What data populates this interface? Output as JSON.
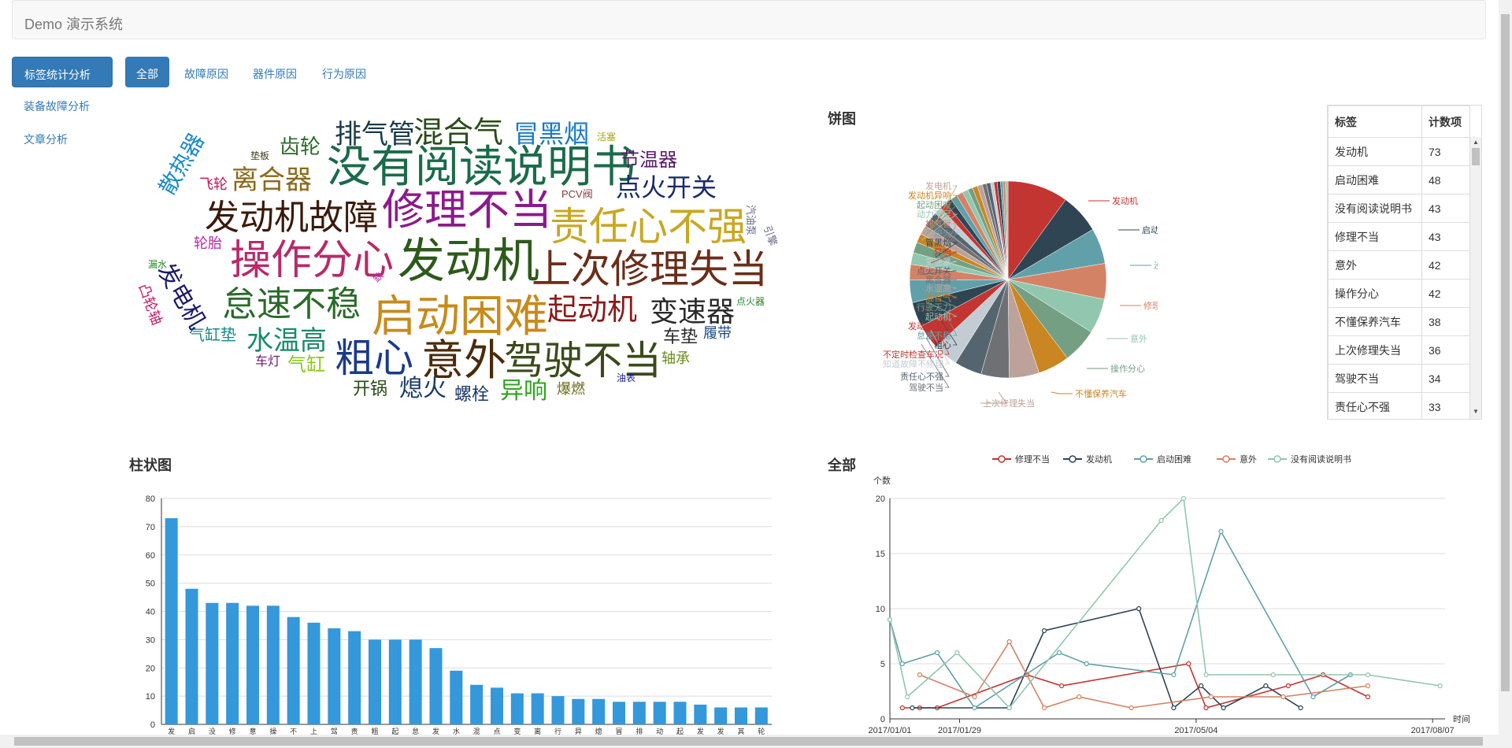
{
  "app": {
    "brand": "Demo 演示系统"
  },
  "sidebar": {
    "primary": "标签统计分析",
    "links": [
      "装备故障分析",
      "文章分析"
    ]
  },
  "tabs": [
    "全部",
    "故障原因",
    "器件原因",
    "行为原因"
  ],
  "wordcloud": [
    {
      "t": "没有阅读说明书",
      "x": 235,
      "y": 44,
      "s": 56,
      "c": "#1a6b4a"
    },
    {
      "t": "修理不当",
      "x": 305,
      "y": 100,
      "s": 54,
      "c": "#8b1a8b"
    },
    {
      "t": "发动机",
      "x": 325,
      "y": 162,
      "s": 60,
      "c": "#2d5a1a"
    },
    {
      "t": "上次修理失当",
      "x": 495,
      "y": 177,
      "s": 50,
      "c": "#6b2d1a"
    },
    {
      "t": "启动困难",
      "x": 292,
      "y": 234,
      "s": 56,
      "c": "#c88a1a"
    },
    {
      "t": "意外",
      "x": 355,
      "y": 291,
      "s": 54,
      "c": "#4a2a0a"
    },
    {
      "t": "驾驶不当",
      "x": 460,
      "y": 293,
      "s": 50,
      "c": "#3a4a1a"
    },
    {
      "t": "责任心不强",
      "x": 518,
      "y": 123,
      "s": 50,
      "c": "#c8a822"
    },
    {
      "t": "操作分心",
      "x": 112,
      "y": 165,
      "s": 52,
      "c": "#b82a6a"
    },
    {
      "t": "发动机故障",
      "x": 80,
      "y": 115,
      "s": 44,
      "c": "#3a1a0a"
    },
    {
      "t": "怠速不稳",
      "x": 102,
      "y": 225,
      "s": 44,
      "c": "#2a6a2a"
    },
    {
      "t": "粗心",
      "x": 245,
      "y": 290,
      "s": 50,
      "c": "#1a3a8a"
    },
    {
      "t": "起动机",
      "x": 515,
      "y": 235,
      "s": 38,
      "c": "#8a1a1a"
    },
    {
      "t": "变速器",
      "x": 645,
      "y": 238,
      "s": 36,
      "c": "#2a2a2a"
    },
    {
      "t": "混合气",
      "x": 345,
      "y": 10,
      "s": 38,
      "c": "#2a4a1a"
    },
    {
      "t": "排气管",
      "x": 245,
      "y": 14,
      "s": 34,
      "c": "#1a3a4a"
    },
    {
      "t": "冒黑烟",
      "x": 472,
      "y": 14,
      "s": 32,
      "c": "#1a7ac8"
    },
    {
      "t": "点火开关",
      "x": 602,
      "y": 82,
      "s": 32,
      "c": "#1a2a6a"
    },
    {
      "t": "离合器",
      "x": 114,
      "y": 72,
      "s": 34,
      "c": "#8a6a1a"
    },
    {
      "t": "水温高",
      "x": 133,
      "y": 276,
      "s": 34,
      "c": "#1a8a6a"
    },
    {
      "t": "节温器",
      "x": 608,
      "y": 52,
      "s": 24,
      "c": "#5a1a6a"
    },
    {
      "t": "齿轮",
      "x": 175,
      "y": 33,
      "s": 26,
      "c": "#2a6a2a"
    },
    {
      "t": "车垫",
      "x": 662,
      "y": 277,
      "s": 22,
      "c": "#2a2a2a"
    },
    {
      "t": "履带",
      "x": 713,
      "y": 274,
      "s": 18,
      "c": "#1a4a8a"
    },
    {
      "t": "轴承",
      "x": 660,
      "y": 306,
      "s": 18,
      "c": "#6a8a1a"
    },
    {
      "t": "气缸垫",
      "x": 60,
      "y": 276,
      "s": 20,
      "c": "#1a8a8a"
    },
    {
      "t": "车灯",
      "x": 144,
      "y": 312,
      "s": 16,
      "c": "#6a1a6a"
    },
    {
      "t": "气缸",
      "x": 185,
      "y": 312,
      "s": 24,
      "c": "#8ac81a"
    },
    {
      "t": "开锅",
      "x": 268,
      "y": 343,
      "s": 22,
      "c": "#2a4a1a"
    },
    {
      "t": "熄火",
      "x": 327,
      "y": 339,
      "s": 30,
      "c": "#1a3a6a"
    },
    {
      "t": "螺栓",
      "x": 397,
      "y": 350,
      "s": 22,
      "c": "#1a3a6a"
    },
    {
      "t": "异响",
      "x": 455,
      "y": 342,
      "s": 30,
      "c": "#2aa81a"
    },
    {
      "t": "爆燃",
      "x": 527,
      "y": 345,
      "s": 18,
      "c": "#6a6a1a"
    },
    {
      "t": "油表",
      "x": 603,
      "y": 334,
      "s": 12,
      "c": "#1a1a8a"
    },
    {
      "t": "点火器",
      "x": 755,
      "y": 237,
      "s": 12,
      "c": "#1a8a2a"
    },
    {
      "t": "活塞",
      "x": 578,
      "y": 28,
      "s": 12,
      "c": "#a8a81a"
    },
    {
      "t": "垫板",
      "x": 138,
      "y": 52,
      "s": 12,
      "c": "#3a3a1a"
    },
    {
      "t": "PCV阀",
      "x": 533,
      "y": 100,
      "s": 13,
      "c": "#8a3a3a"
    },
    {
      "t": "飞轮",
      "x": 73,
      "y": 85,
      "s": 18,
      "c": "#b81a5a"
    },
    {
      "t": "轮胎",
      "x": 66,
      "y": 160,
      "s": 18,
      "c": "#b82aa8"
    },
    {
      "t": "漏水",
      "x": 8,
      "y": 190,
      "s": 12,
      "c": "#2a8a2a"
    }
  ],
  "wordcloud_vertical": [
    {
      "t": "散热器",
      "x": 18,
      "y": 98,
      "s": 28,
      "c": "#1a8ac8",
      "r": -60
    },
    {
      "t": "发电机",
      "x": 40,
      "y": 190,
      "s": 30,
      "c": "#1a1a6a",
      "r": 60
    },
    {
      "t": "凸轮轴",
      "x": 10,
      "y": 218,
      "s": 18,
      "c": "#c81a6a",
      "r": 70
    },
    {
      "t": "汽油泵",
      "x": 780,
      "y": 120,
      "s": 13,
      "c": "#6a6a8a",
      "r": 90
    },
    {
      "t": "引擎",
      "x": 800,
      "y": 145,
      "s": 13,
      "c": "#6a6a8a",
      "r": 70
    },
    {
      "t": "缺",
      "x": 292,
      "y": 212,
      "s": 12,
      "c": "#b82aa8",
      "r": -45
    }
  ],
  "pie": {
    "title": "饼图",
    "values": [
      73,
      48,
      43,
      43,
      42,
      42,
      38,
      36,
      34,
      33,
      30,
      30,
      30,
      27,
      19,
      14,
      13,
      11,
      11,
      10,
      9,
      9,
      8,
      8,
      8,
      8,
      7,
      6,
      6,
      6,
      5,
      5,
      4,
      4,
      4,
      3,
      3,
      3
    ],
    "colors": [
      "#c23531",
      "#2f4554",
      "#61a0a8",
      "#d48265",
      "#91c7ae",
      "#749f83",
      "#ca8622",
      "#bda29a",
      "#6e7074",
      "#546570",
      "#c4ccd3",
      "#c23531",
      "#2f4554",
      "#61a0a8",
      "#d48265",
      "#91c7ae",
      "#749f83",
      "#ca8622",
      "#bda29a",
      "#6e7074",
      "#546570",
      "#c4ccd3",
      "#c23531",
      "#2f4554",
      "#61a0a8",
      "#d48265",
      "#91c7ae",
      "#749f83",
      "#ca8622",
      "#bda29a",
      "#6e7074",
      "#546570",
      "#c4ccd3",
      "#c23531",
      "#2f4554",
      "#61a0a8",
      "#d48265",
      "#91c7ae"
    ],
    "labels_right": [
      {
        "t": "发动机",
        "c": "#c23531"
      },
      {
        "t": "启动困难",
        "c": "#2f4554"
      },
      {
        "t": "没有阅读说明书",
        "c": "#61a0a8"
      },
      {
        "t": "修理不当",
        "c": "#d48265"
      },
      {
        "t": "意外",
        "c": "#91c7ae"
      },
      {
        "t": "操作分心",
        "c": "#749f83"
      },
      {
        "t": "不懂保养汽车",
        "c": "#ca8622"
      },
      {
        "t": "上次修理失当",
        "c": "#bda29a"
      }
    ],
    "labels_left": [
      {
        "t": "驾驶不当",
        "c": "#6e7074"
      },
      {
        "t": "责任心不强",
        "c": "#546570"
      },
      {
        "t": "知道故障不修理",
        "c": "#c4ccd3"
      },
      {
        "t": "不定时检查车况",
        "c": "#c23531"
      },
      {
        "t": "粗心",
        "c": "#2f4554"
      },
      {
        "t": "怠速不稳",
        "c": "#61a0a8"
      },
      {
        "t": "发动机故障",
        "c": "#c23531"
      },
      {
        "t": "起动机",
        "c": "#91c7ae"
      },
      {
        "t": "行驶无力",
        "c": "#749f83"
      },
      {
        "t": "混合气",
        "c": "#ca8622"
      },
      {
        "t": "水温高",
        "c": "#bda29a"
      },
      {
        "t": "离合器",
        "c": "#6e7074"
      },
      {
        "t": "点火开关",
        "c": "#546570"
      },
      {
        "t": "变速器",
        "c": "#c4ccd3"
      },
      {
        "t": "异响",
        "c": "#c23531"
      },
      {
        "t": "冒黑烟",
        "c": "#2f4554"
      },
      {
        "t": "熄火",
        "c": "#61a0a8"
      },
      {
        "t": "排气管",
        "c": "#d48265"
      },
      {
        "t": "动力不足",
        "c": "#91c7ae"
      },
      {
        "t": "起动困难",
        "c": "#749f83"
      },
      {
        "t": "发动机异响",
        "c": "#ca8622"
      },
      {
        "t": "发电机",
        "c": "#bda29a"
      }
    ]
  },
  "table": {
    "headers": [
      "标签",
      "计数项"
    ],
    "rows": [
      [
        "发动机",
        "73"
      ],
      [
        "启动困难",
        "48"
      ],
      [
        "没有阅读说明书",
        "43"
      ],
      [
        "修理不当",
        "43"
      ],
      [
        "意外",
        "42"
      ],
      [
        "操作分心",
        "42"
      ],
      [
        "不懂保养汽车",
        "38"
      ],
      [
        "上次修理失当",
        "36"
      ],
      [
        "驾驶不当",
        "34"
      ],
      [
        "责任心不强",
        "33"
      ]
    ]
  },
  "bar": {
    "title": "柱状图",
    "yticks": [
      "0",
      "10",
      "20",
      "30",
      "40",
      "50",
      "60",
      "70",
      "80"
    ],
    "xlabels": [
      "发",
      "启",
      "没",
      "修",
      "意",
      "操",
      "不",
      "上",
      "驾",
      "责",
      "粗",
      "起",
      "怠",
      "发",
      "水",
      "混",
      "点",
      "变",
      "离",
      "行",
      "异",
      "熄",
      "冒",
      "排",
      "动",
      "起",
      "发",
      "发",
      "其",
      "轮"
    ]
  },
  "line": {
    "title": "全部",
    "legend": [
      "修理不当",
      "发动机",
      "启动困难",
      "意外",
      "没有阅读说明书"
    ],
    "colors": [
      "#c23531",
      "#2f4554",
      "#61a0a8",
      "#d48265",
      "#91c7ae"
    ],
    "yname": "个数",
    "xname": "时间",
    "yticks": [
      "0",
      "5",
      "10",
      "15",
      "20"
    ],
    "xticks": [
      "2017/01/01",
      "2017/01/29",
      "2017/05/04",
      "2017/08/07"
    ]
  },
  "chart_data": [
    {
      "type": "pie",
      "title": "饼图",
      "categories": [
        "发动机",
        "启动困难",
        "没有阅读说明书",
        "修理不当",
        "意外",
        "操作分心",
        "不懂保养汽车",
        "上次修理失当",
        "驾驶不当",
        "责任心不强"
      ],
      "values": [
        73,
        48,
        43,
        43,
        42,
        42,
        38,
        36,
        34,
        33
      ]
    },
    {
      "type": "bar",
      "title": "柱状图",
      "values": [
        73,
        48,
        43,
        43,
        42,
        42,
        38,
        36,
        34,
        33,
        30,
        30,
        30,
        27,
        19,
        14,
        13,
        11,
        11,
        10,
        9,
        9,
        8,
        8,
        8,
        8,
        7,
        6,
        6,
        6
      ],
      "ylim": [
        0,
        80
      ]
    },
    {
      "type": "line",
      "title": "全部",
      "ylabel": "个数",
      "xlabel": "时间",
      "ylim": [
        0,
        20
      ],
      "series": [
        {
          "name": "修理不当",
          "x": [
            "2017/01/06",
            "2017/01/13",
            "2017/01/20",
            "2017/02/25",
            "2017/03/11",
            "2017/05/01",
            "2017/05/08",
            "2017/06/10",
            "2017/06/24",
            "2017/07/12"
          ],
          "values": [
            1,
            1,
            1,
            4,
            3,
            5,
            1,
            3,
            4,
            2
          ]
        },
        {
          "name": "发动机",
          "x": [
            "2017/01/10",
            "2017/02/18",
            "2017/03/04",
            "2017/04/11",
            "2017/04/25",
            "2017/05/06",
            "2017/05/15",
            "2017/06/01",
            "2017/06/15"
          ],
          "values": [
            1,
            1,
            8,
            10,
            1,
            3,
            1,
            3,
            1
          ]
        },
        {
          "name": "启动困难",
          "x": [
            "2017/01/01",
            "2017/01/06",
            "2017/01/20",
            "2017/02/04",
            "2017/03/10",
            "2017/03/21",
            "2017/04/25",
            "2017/05/14",
            "2017/06/20",
            "2017/07/05"
          ],
          "values": [
            9,
            5,
            6,
            1,
            6,
            5,
            4,
            17,
            2,
            4
          ]
        },
        {
          "name": "意外",
          "x": [
            "2017/01/13",
            "2017/02/04",
            "2017/02/18",
            "2017/03/04",
            "2017/03/18",
            "2017/04/08",
            "2017/05/10",
            "2017/06/08",
            "2017/07/12"
          ],
          "values": [
            4,
            2,
            7,
            1,
            2,
            1,
            2,
            2,
            3
          ]
        },
        {
          "name": "没有阅读说明书",
          "x": [
            "2017/01/01",
            "2017/01/08",
            "2017/01/28",
            "2017/02/18",
            "2017/04/20",
            "2017/04/29",
            "2017/05/08",
            "2017/06/04",
            "2017/07/12",
            "2017/08/10"
          ],
          "values": [
            9,
            2,
            6,
            1,
            18,
            20,
            4,
            4,
            4,
            3
          ]
        }
      ]
    }
  ]
}
